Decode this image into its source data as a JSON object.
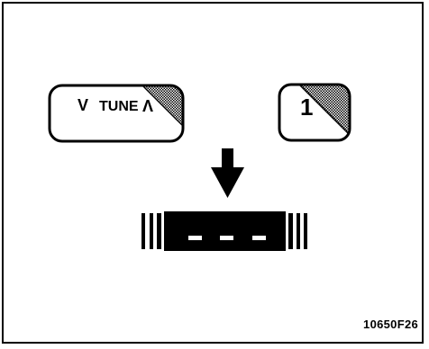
{
  "tune_button": {
    "down_glyph": "V",
    "label": "TUNE",
    "up_glyph": "Λ"
  },
  "preset_button": {
    "label": "1"
  },
  "display": {
    "segments": "- - -"
  },
  "figure_code": "10650F26",
  "icons": {
    "arrow": "down-arrow-icon"
  }
}
